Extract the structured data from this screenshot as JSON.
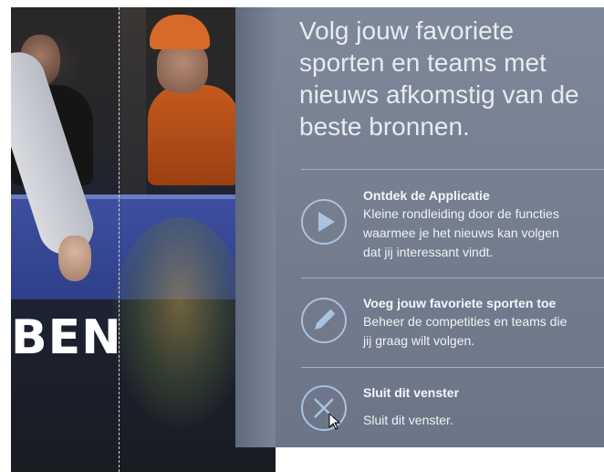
{
  "background": {
    "photo_word": "BEN"
  },
  "panel": {
    "headline": "Volg jouw favoriete sporten en teams met nieuws afkomstig van de beste bronnen.",
    "items": [
      {
        "icon": "play-icon",
        "title": "Ontdek de Applicatie",
        "description": "Kleine rondleiding door de functies\nwaarmee je het nieuws kan volgen\ndat jij interessant vindt."
      },
      {
        "icon": "pencil-icon",
        "title": "Voeg jouw favoriete sporten toe",
        "description": "Beheer de competities en teams die\njij graag wilt volgen."
      },
      {
        "icon": "close-icon",
        "title": "Sluit dit venster",
        "description": "Sluit dit venster."
      }
    ]
  },
  "colors": {
    "panel_bg": "#7e8899",
    "icon_accent": "#a9c3e0",
    "text": "#f0f2f6"
  }
}
